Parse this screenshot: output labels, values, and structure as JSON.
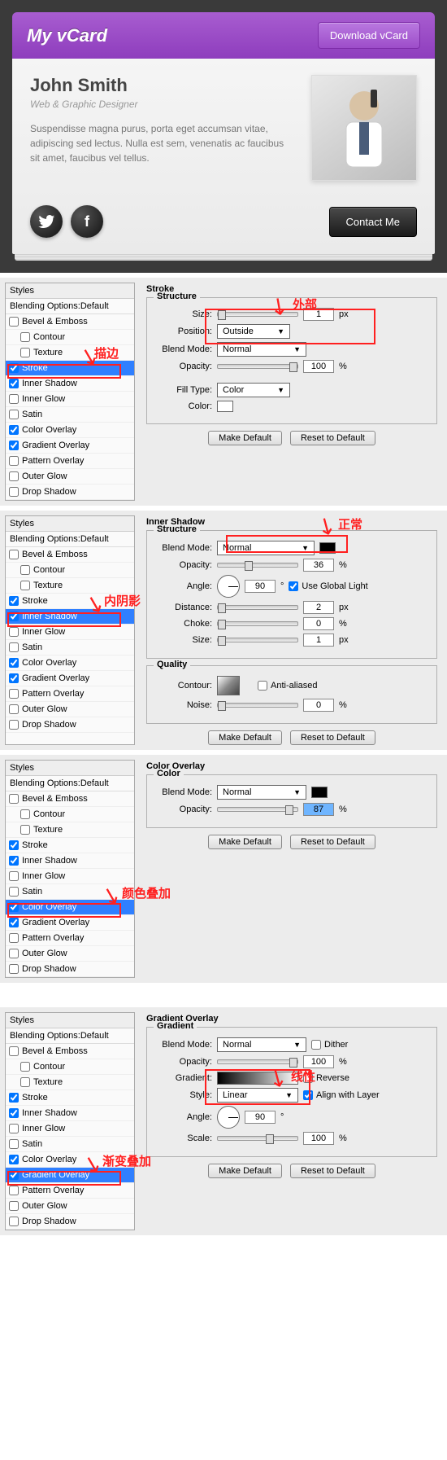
{
  "vcard": {
    "title": "My vCard",
    "download_btn": "Download vCard",
    "name": "John Smith",
    "role": "Web & Graphic Designer",
    "desc": "Suspendisse magna purus, porta eget accumsan vitae, adipiscing sed lectus. Nulla est sem, venenatis ac faucibus sit amet, faucibus vel tellus.",
    "contact_btn": "Contact Me"
  },
  "styles_header": "Styles",
  "blending_options": "Blending Options:Default",
  "style_names": {
    "bevel": "Bevel & Emboss",
    "contour": "Contour",
    "texture": "Texture",
    "stroke": "Stroke",
    "inner_shadow": "Inner Shadow",
    "inner_glow": "Inner Glow",
    "satin": "Satin",
    "color_overlay": "Color Overlay",
    "gradient_overlay": "Gradient Overlay",
    "pattern_overlay": "Pattern Overlay",
    "outer_glow": "Outer Glow",
    "drop_shadow": "Drop Shadow"
  },
  "labels": {
    "structure": "Structure",
    "quality": "Quality",
    "color": "Color",
    "gradient": "Gradient",
    "size": "Size:",
    "position": "Position:",
    "blend_mode": "Blend Mode:",
    "opacity": "Opacity:",
    "fill_type": "Fill Type:",
    "color_lbl": "Color:",
    "angle": "Angle:",
    "distance": "Distance:",
    "choke": "Choke:",
    "contour": "Contour:",
    "noise": "Noise:",
    "gradient_lbl": "Gradient:",
    "style_lbl": "Style:",
    "scale": "Scale:",
    "use_global_light": "Use Global Light",
    "anti_aliased": "Anti-aliased",
    "dither": "Dither",
    "reverse": "Reverse",
    "align_layer": "Align with Layer",
    "make_default": "Make Default",
    "reset_default": "Reset to Default",
    "px": "px",
    "pct": "%",
    "deg": "°"
  },
  "panels": {
    "stroke": {
      "title": "Stroke",
      "size": "1",
      "position": "Outside",
      "blend_mode": "Normal",
      "opacity": "100",
      "fill_type": "Color",
      "anno_highlight": "描边",
      "anno_outside": "外部"
    },
    "inner_shadow": {
      "title": "Inner Shadow",
      "blend_mode": "Normal",
      "opacity": "36",
      "angle": "90",
      "distance": "2",
      "choke": "0",
      "size": "1",
      "noise": "0",
      "anno_highlight": "内阴影",
      "anno_normal": "正常"
    },
    "color_overlay": {
      "title": "Color Overlay",
      "blend_mode": "Normal",
      "opacity": "87",
      "anno_highlight": "颜色叠加"
    },
    "gradient_overlay": {
      "title": "Gradient Overlay",
      "blend_mode": "Normal",
      "opacity": "100",
      "style": "Linear",
      "angle": "90",
      "scale": "100",
      "anno_highlight": "渐变叠加",
      "anno_linear": "线性"
    }
  }
}
